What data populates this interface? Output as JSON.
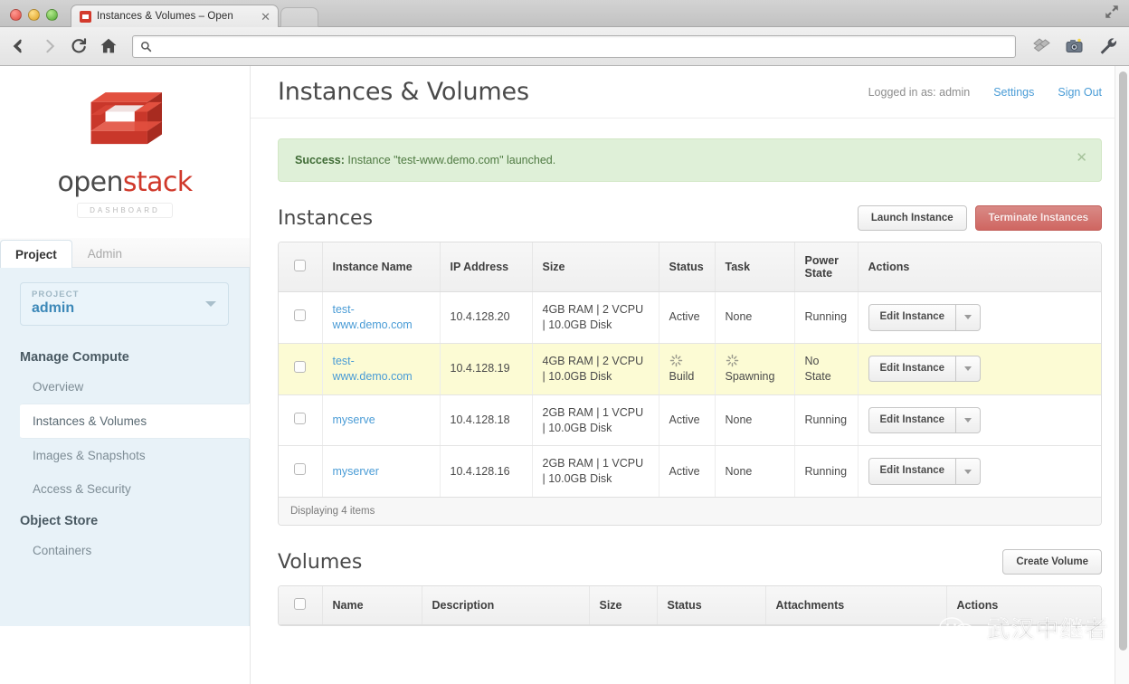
{
  "browser": {
    "tab_title": "Instances & Volumes – Open",
    "tab_close": "✕",
    "url_value": "",
    "url_placeholder": ""
  },
  "sidebar": {
    "brand_open": "open",
    "brand_stack": "stack",
    "brand_sub": "DASHBOARD",
    "scope_tabs": [
      {
        "label": "Project",
        "active": true
      },
      {
        "label": "Admin",
        "active": false
      }
    ],
    "project_label": "PROJECT",
    "project_value": "admin",
    "groups": [
      {
        "title": "Manage Compute",
        "items": [
          {
            "label": "Overview",
            "active": false
          },
          {
            "label": "Instances & Volumes",
            "active": true
          },
          {
            "label": "Images & Snapshots",
            "active": false
          },
          {
            "label": "Access & Security",
            "active": false
          }
        ]
      },
      {
        "title": "Object Store",
        "items": [
          {
            "label": "Containers",
            "active": false
          }
        ]
      }
    ]
  },
  "header": {
    "title": "Instances & Volumes",
    "logged_in": "Logged in as: admin",
    "settings": "Settings",
    "sign_out": "Sign Out"
  },
  "alert": {
    "prefix": "Success:",
    "message": "Instance \"test-www.demo.com\" launched.",
    "close": "✕"
  },
  "instances": {
    "title": "Instances",
    "launch_label": "Launch Instance",
    "terminate_label": "Terminate Instances",
    "columns": [
      "",
      "Instance Name",
      "IP Address",
      "Size",
      "Status",
      "Task",
      "Power State",
      "Actions"
    ],
    "action_label": "Edit Instance",
    "rows": [
      {
        "name": "test-www.demo.com",
        "ip": "10.4.128.20",
        "size": "4GB RAM | 2 VCPU | 10.0GB Disk",
        "status": "Active",
        "task": "None",
        "power": "Running",
        "highlight": false,
        "status_spinner": false,
        "task_spinner": false
      },
      {
        "name": "test-www.demo.com",
        "ip": "10.4.128.19",
        "size": "4GB RAM | 2 VCPU | 10.0GB Disk",
        "status": "Build",
        "task": "Spawning",
        "power": "No State",
        "highlight": true,
        "status_spinner": true,
        "task_spinner": true
      },
      {
        "name": "myserve",
        "ip": "10.4.128.18",
        "size": "2GB RAM | 1 VCPU | 10.0GB Disk",
        "status": "Active",
        "task": "None",
        "power": "Running",
        "highlight": false,
        "status_spinner": false,
        "task_spinner": false
      },
      {
        "name": "myserver",
        "ip": "10.4.128.16",
        "size": "2GB RAM | 1 VCPU | 10.0GB Disk",
        "status": "Active",
        "task": "None",
        "power": "Running",
        "highlight": false,
        "status_spinner": false,
        "task_spinner": false
      }
    ],
    "footer": "Displaying 4 items"
  },
  "volumes": {
    "title": "Volumes",
    "create_label": "Create Volume",
    "columns": [
      "",
      "Name",
      "Description",
      "Size",
      "Status",
      "Attachments",
      "Actions"
    ]
  },
  "watermark": {
    "text": "武汉中继者"
  },
  "colors": {
    "accent_link": "#4a9cd6",
    "brand_red": "#d0392b",
    "success_bg": "#dff0d8",
    "warn_row": "#fcfbd4",
    "danger_btn": "#cf6661"
  }
}
